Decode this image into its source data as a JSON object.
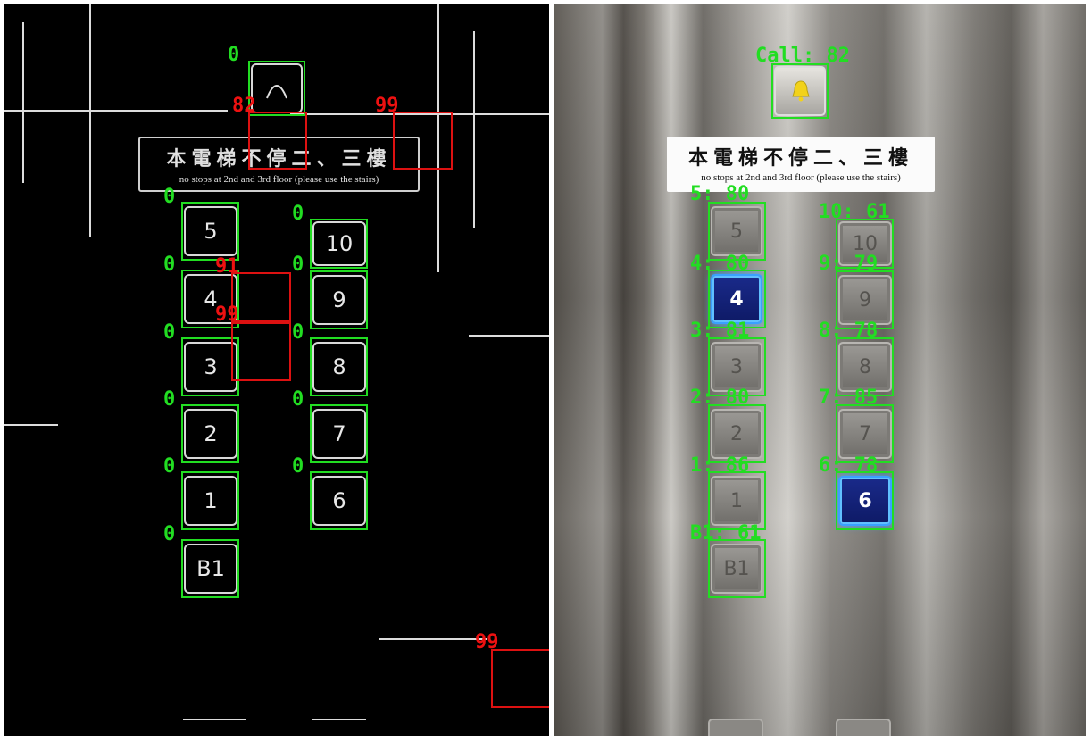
{
  "left_panel": {
    "sign_title": "本電梯不停二、三樓",
    "sign_subtitle": "no stops at 2nd and 3rd floor (please use the stairs)",
    "call_button_label": "0",
    "buttons": [
      {
        "text": "5",
        "score": "0"
      },
      {
        "text": "10",
        "score": "0"
      },
      {
        "text": "4",
        "score": "0"
      },
      {
        "text": "9",
        "score": "0"
      },
      {
        "text": "3",
        "score": "0"
      },
      {
        "text": "8",
        "score": "0"
      },
      {
        "text": "2",
        "score": "0"
      },
      {
        "text": "7",
        "score": "0"
      },
      {
        "text": "1",
        "score": "0"
      },
      {
        "text": "6",
        "score": "0"
      },
      {
        "text": "B1",
        "score": "0"
      }
    ],
    "red_scores": [
      "82",
      "99",
      "91",
      "99",
      "99"
    ]
  },
  "right_panel": {
    "sign_title": "本電梯不停二、三樓",
    "sign_subtitle": "no stops at 2nd and 3rd floor (please use the stairs)",
    "call_label": "Call: 82",
    "buttons": [
      {
        "text": "5",
        "label": "5: 80",
        "lit": false
      },
      {
        "text": "10",
        "label": "10: 61",
        "lit": false
      },
      {
        "text": "4",
        "label": "4: 80",
        "lit": true
      },
      {
        "text": "9",
        "label": "9: 79",
        "lit": false
      },
      {
        "text": "3",
        "label": "3: 81",
        "lit": false
      },
      {
        "text": "8",
        "label": "8: 78",
        "lit": false
      },
      {
        "text": "2",
        "label": "2: 80",
        "lit": false
      },
      {
        "text": "7",
        "label": "7: 85",
        "lit": false
      },
      {
        "text": "1",
        "label": "1: 86",
        "lit": false
      },
      {
        "text": "6",
        "label": "6: 78",
        "lit": true
      },
      {
        "text": "B1",
        "label": "B1: 61",
        "lit": false
      }
    ]
  },
  "colors": {
    "detection_box": "#22dd22",
    "rejected_box": "#dd1111",
    "lit_button": "#3aa0ff"
  }
}
